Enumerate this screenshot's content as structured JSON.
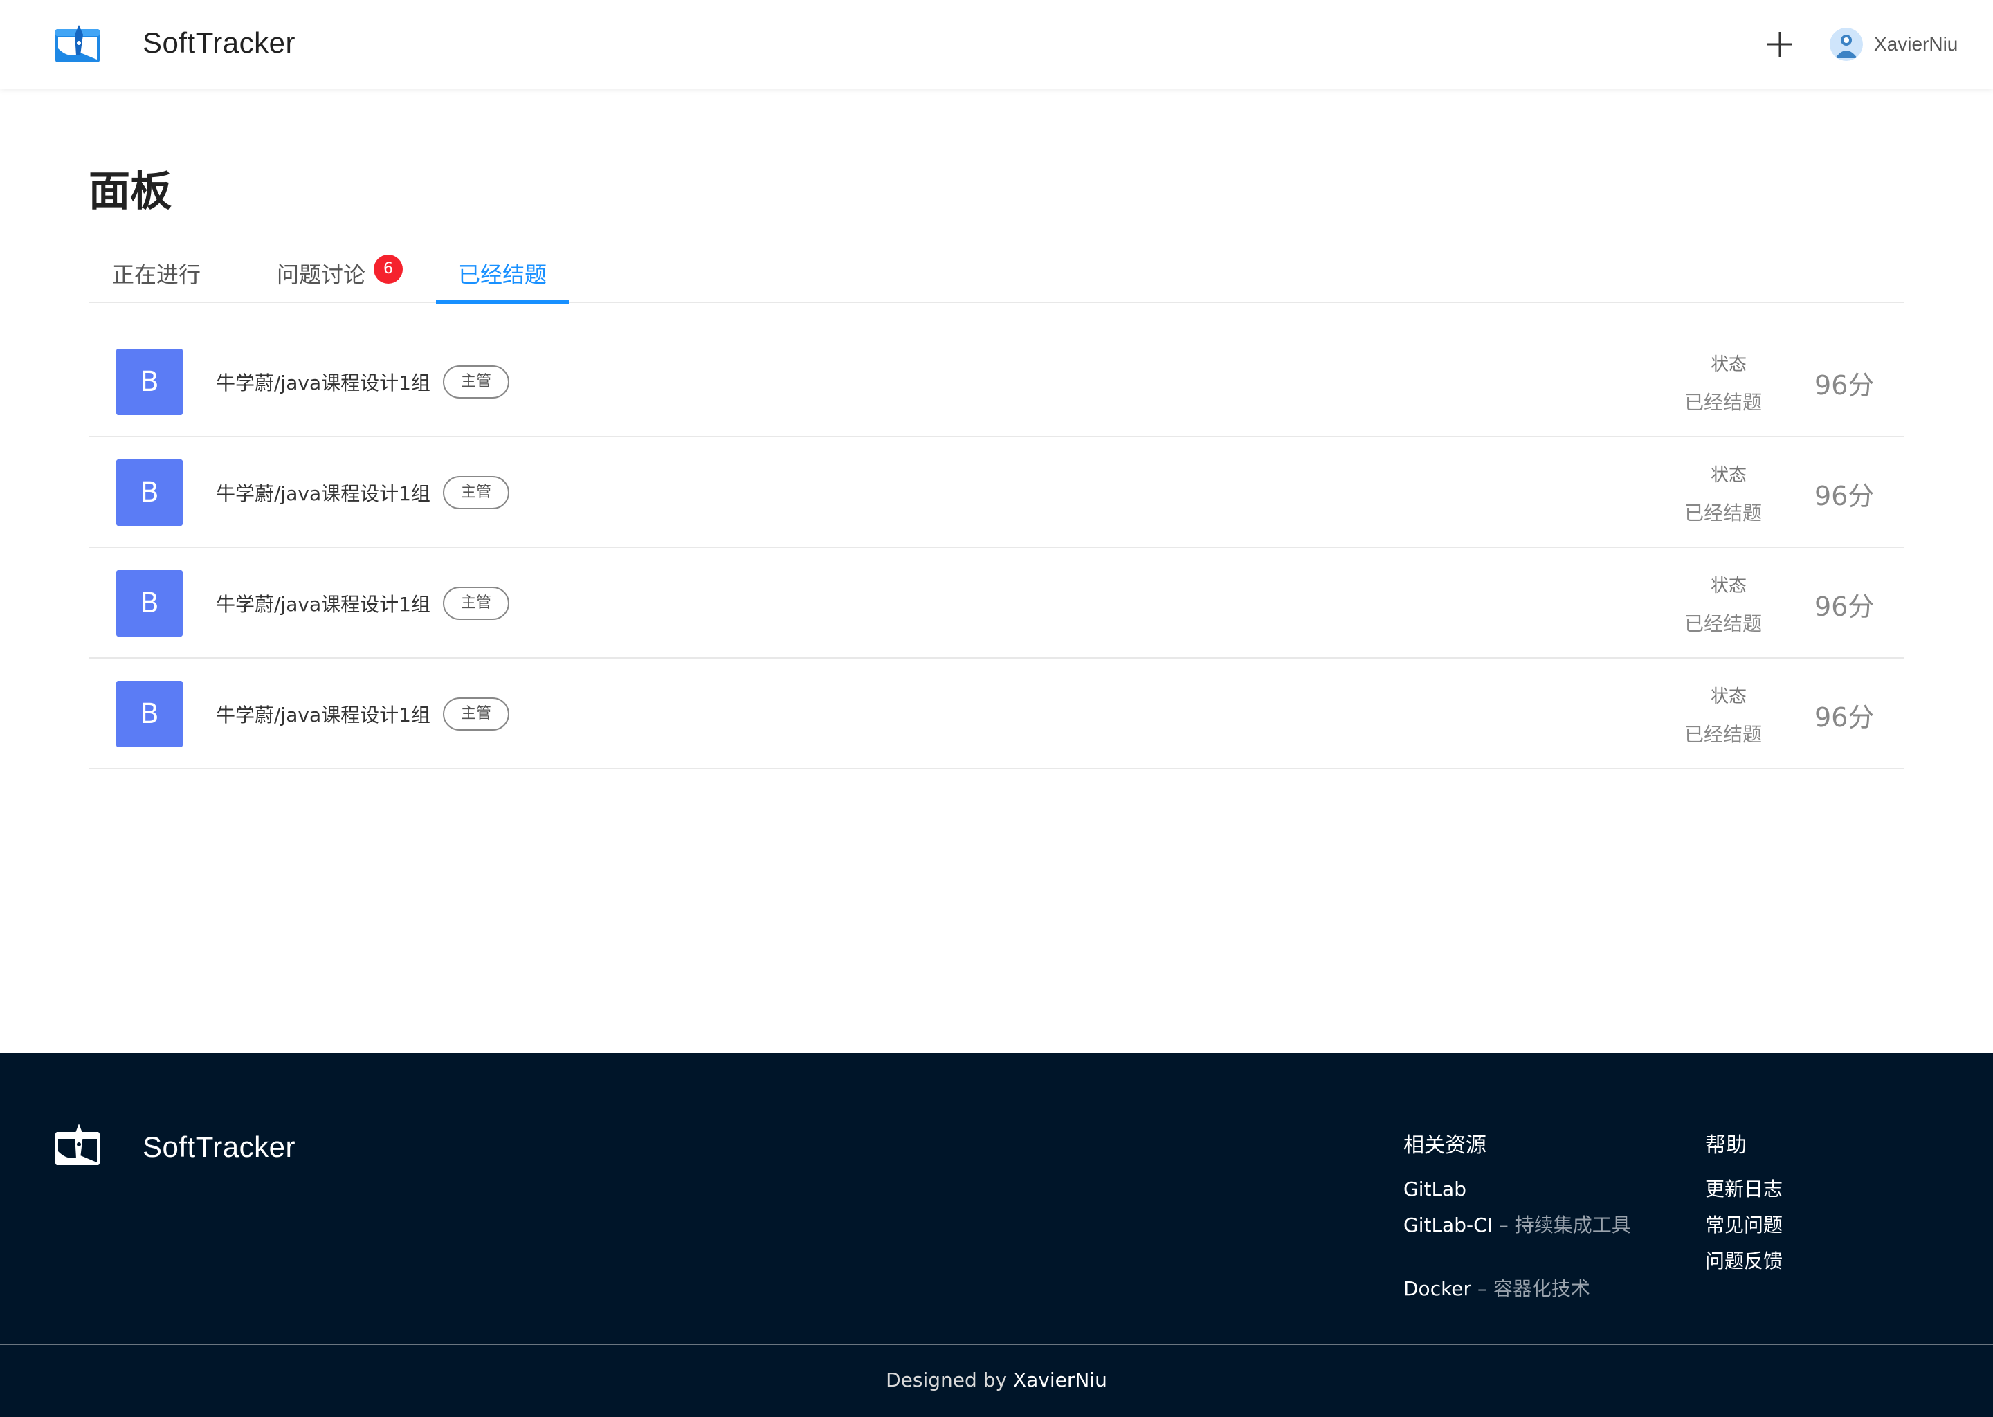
{
  "header": {
    "brand": "SoftTracker",
    "username": "XavierNiu",
    "add_icon": "plus-icon"
  },
  "main": {
    "title": "面板",
    "tabs": [
      {
        "label": "正在进行",
        "active": false
      },
      {
        "label": "问题讨论",
        "badge": "6",
        "active": false
      },
      {
        "label": "已经结题",
        "active": true
      }
    ],
    "projects": [
      {
        "avatar": "B",
        "name": "牛学蔚/java课程设计1组",
        "role": "主管",
        "status_label": "状态",
        "status": "已经结题",
        "score": "96分"
      },
      {
        "avatar": "B",
        "name": "牛学蔚/java课程设计1组",
        "role": "主管",
        "status_label": "状态",
        "status": "已经结题",
        "score": "96分"
      },
      {
        "avatar": "B",
        "name": "牛学蔚/java课程设计1组",
        "role": "主管",
        "status_label": "状态",
        "status": "已经结题",
        "score": "96分"
      },
      {
        "avatar": "B",
        "name": "牛学蔚/java课程设计1组",
        "role": "主管",
        "status_label": "状态",
        "status": "已经结题",
        "score": "96分"
      }
    ]
  },
  "footer": {
    "brand": "SoftTracker",
    "resources": {
      "title": "相关资源",
      "links": [
        {
          "name": "GitLab",
          "desc": ""
        },
        {
          "name": "GitLab-CI",
          "desc": " – 持续集成工具"
        },
        {
          "name": "Docker",
          "desc": " – 容器化技术"
        }
      ]
    },
    "help": {
      "title": "帮助",
      "links": [
        "更新日志",
        "常见问题",
        "问题反馈"
      ]
    },
    "copyright_prefix": "Designed by ",
    "copyright_name": "XavierNiu"
  },
  "colors": {
    "accent": "#1890ff",
    "badge": "#f5222d",
    "avatar_bg": "#5b7cf5",
    "footer_bg": "#001529"
  }
}
